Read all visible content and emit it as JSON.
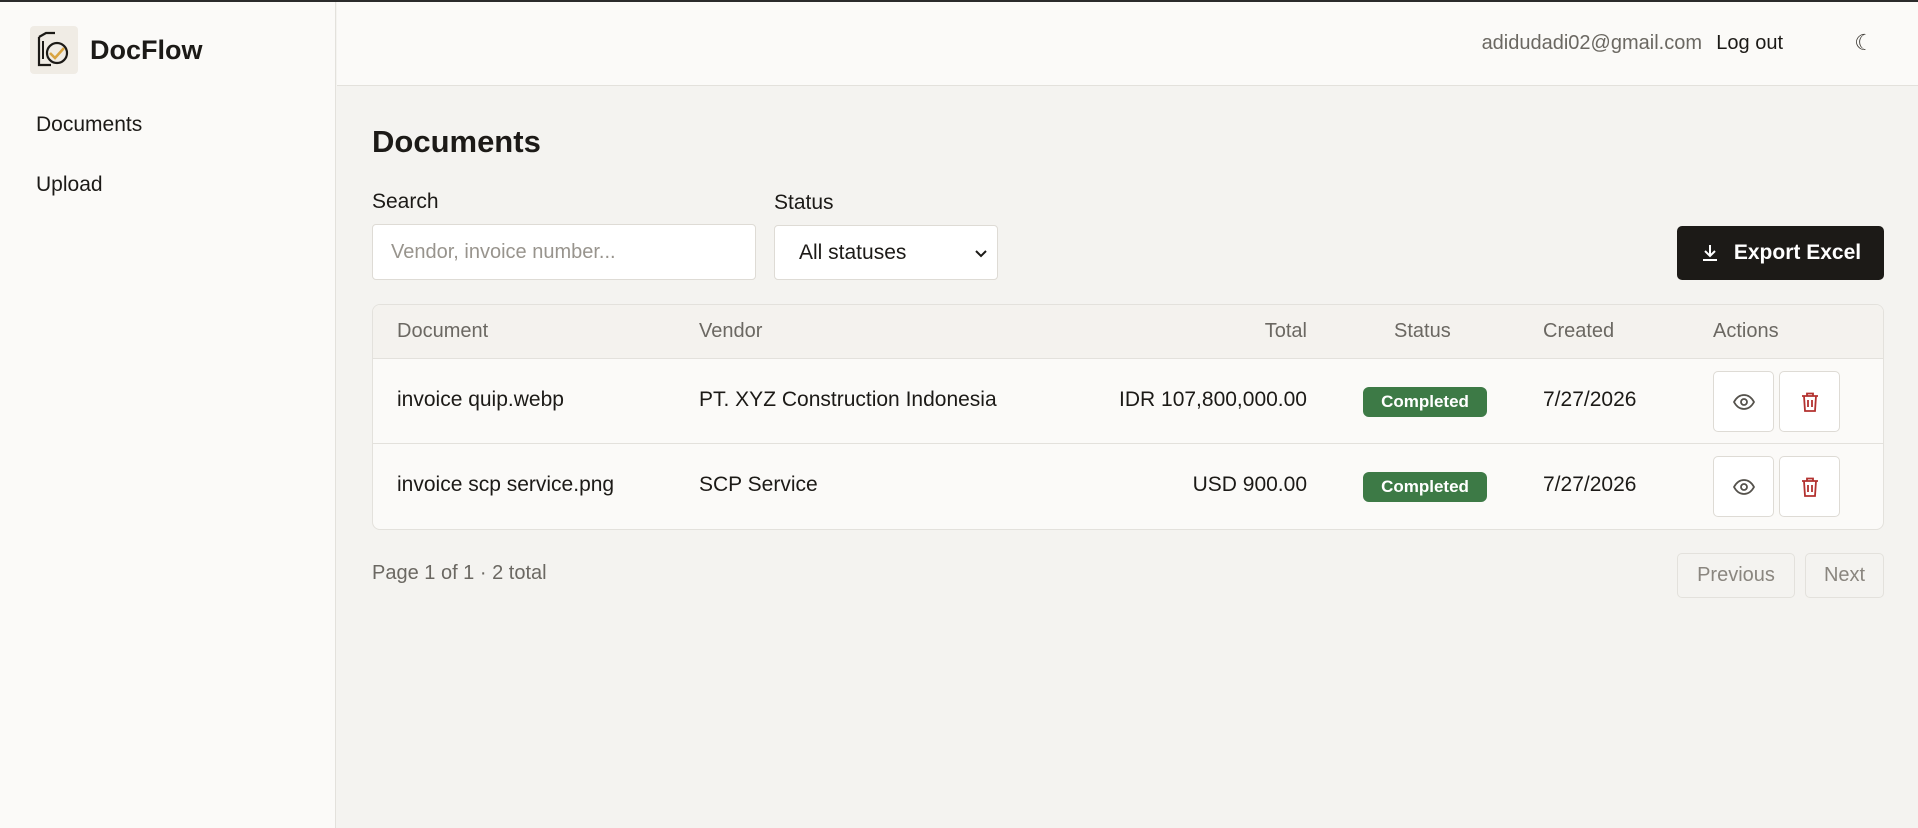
{
  "app": {
    "name": "DocFlow"
  },
  "sidebar": {
    "items": [
      {
        "label": "Documents"
      },
      {
        "label": "Upload"
      }
    ]
  },
  "header": {
    "user_email": "adidudadi02@gmail.com",
    "logout_label": "Log out",
    "theme_icon": "moon-icon"
  },
  "main": {
    "title": "Documents",
    "search": {
      "label": "Search",
      "placeholder": "Vendor, invoice number...",
      "value": ""
    },
    "status_filter": {
      "label": "Status",
      "selected": "All statuses"
    },
    "export_label": "Export Excel",
    "table": {
      "columns": [
        "Document",
        "Vendor",
        "Total",
        "Status",
        "Created",
        "Actions"
      ],
      "rows": [
        {
          "document": "invoice quip.webp",
          "vendor": "PT. XYZ Construction Indonesia",
          "total": "IDR 107,800,000.00",
          "status": "Completed",
          "created": "7/27/2026"
        },
        {
          "document": "invoice scp service.png",
          "vendor": "SCP Service",
          "total": "USD 900.00",
          "status": "Completed",
          "created": "7/27/2026"
        }
      ]
    },
    "pagination": {
      "info": "Page 1 of 1 · 2 total",
      "previous_label": "Previous",
      "next_label": "Next"
    }
  },
  "colors": {
    "accent": "#1c1a17",
    "status_completed": "#3d7a46",
    "delete": "#b3312f"
  }
}
